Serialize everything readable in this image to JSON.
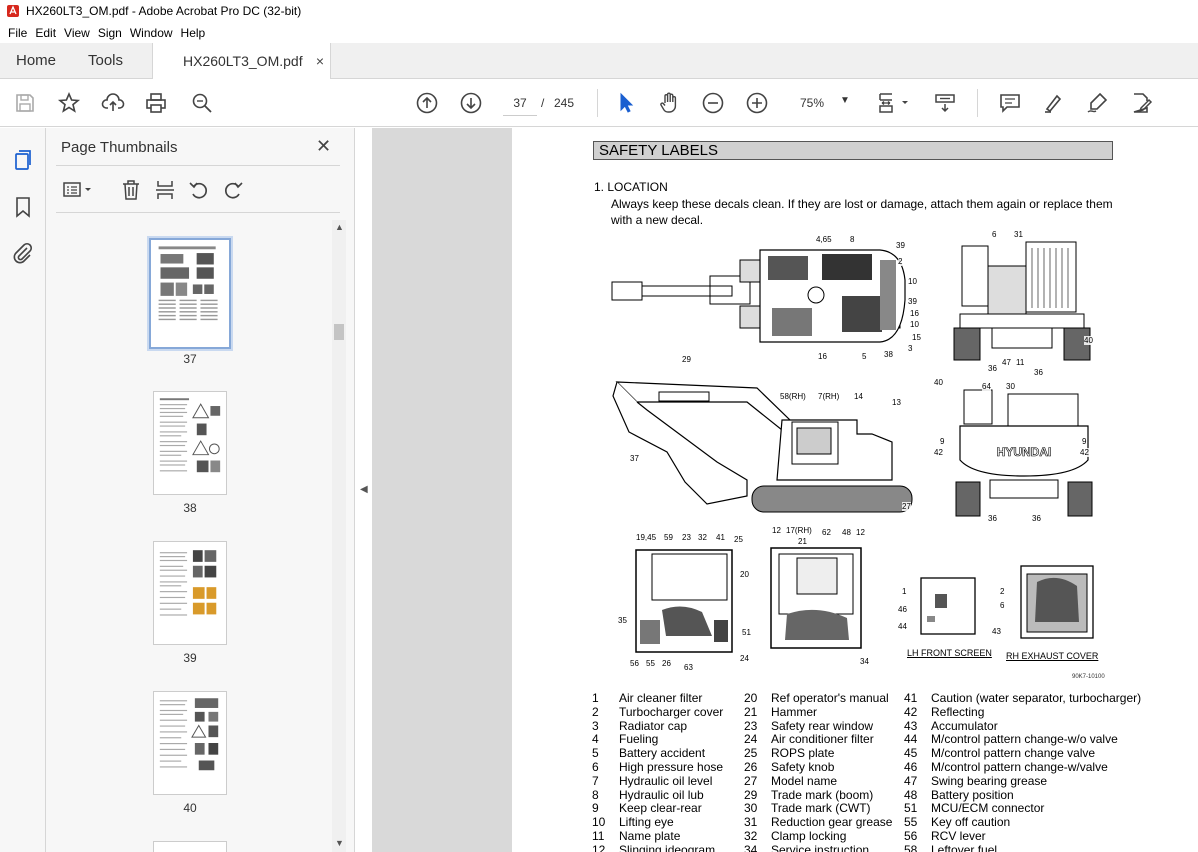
{
  "window": {
    "title": "HX260LT3_OM.pdf - Adobe Acrobat Pro DC (32-bit)"
  },
  "menu": [
    "File",
    "Edit",
    "View",
    "Sign",
    "Window",
    "Help"
  ],
  "tabs": {
    "home": "Home",
    "tools": "Tools",
    "doc": "HX260LT3_OM.pdf",
    "close": "×"
  },
  "toolbar": {
    "page_current": "37",
    "page_sep": "/",
    "page_total": "245",
    "zoom": "75%",
    "icons": [
      "save-icon",
      "star-icon",
      "upload-icon",
      "print-icon",
      "zoom-search-icon",
      "page-up-icon",
      "page-down-icon",
      "cursor-icon",
      "hand-icon",
      "zoom-out-icon",
      "zoom-in-icon",
      "fit-page-icon",
      "scroll-mode-icon",
      "comment-icon",
      "highlight-icon",
      "sign-icon",
      "edit-pdf-icon"
    ]
  },
  "sidebar": {
    "title": "Page Thumbnails",
    "close": "✕",
    "thumbnails": [
      {
        "label": "37",
        "selected": true
      },
      {
        "label": "38",
        "selected": false
      },
      {
        "label": "39",
        "selected": false
      },
      {
        "label": "40",
        "selected": false
      }
    ]
  },
  "doc": {
    "section_title": "SAFETY LABELS",
    "location_heading": "1.  LOCATION",
    "location_text": "Always keep these decals clean.  If they are lost or damage, attach them again or replace them with a new decal.",
    "figure_code": "90K7-10100",
    "captions": {
      "lh_front": "LH FRONT SCREEN",
      "rh_exhaust": "RH EXHAUST COVER"
    },
    "callouts": {
      "top": [
        "4,65",
        "8",
        "39",
        "2",
        "10",
        "39",
        "16",
        "10",
        "15",
        "3",
        "38",
        "5",
        "16"
      ],
      "rear": [
        "6",
        "31",
        "40",
        "36",
        "47",
        "11",
        "36"
      ],
      "side": [
        "29",
        "58(RH)",
        "7(RH)",
        "14",
        "13",
        "37",
        "27",
        "12",
        "17(RH)",
        "62",
        "48",
        "12"
      ],
      "rearview": [
        "40",
        "64",
        "30",
        "9",
        "42",
        "9",
        "42",
        "36",
        "36"
      ],
      "cab": [
        "19,45",
        "59",
        "23",
        "32",
        "41",
        "25",
        "20",
        "35",
        "51",
        "56",
        "55",
        "26",
        "63",
        "24"
      ],
      "cabfront": [
        "21",
        "34"
      ],
      "lhscreen": [
        "1",
        "46",
        "44"
      ],
      "rhcover": [
        "2",
        "6",
        "43"
      ]
    },
    "legend_col1": [
      [
        "1",
        "Air cleaner filter"
      ],
      [
        "2",
        "Turbocharger cover"
      ],
      [
        "3",
        "Radiator cap"
      ],
      [
        "4",
        "Fueling"
      ],
      [
        "5",
        "Battery accident"
      ],
      [
        "6",
        "High pressure hose"
      ],
      [
        "7",
        "Hydraulic oil level"
      ],
      [
        "8",
        "Hydraulic oil lub"
      ],
      [
        "9",
        "Keep clear-rear"
      ],
      [
        "10",
        "Lifting eye"
      ],
      [
        "11",
        "Name plate"
      ],
      [
        "12",
        "Slinging ideogram"
      ]
    ],
    "legend_col2": [
      [
        "20",
        "Ref operator's manual"
      ],
      [
        "21",
        "Hammer"
      ],
      [
        "23",
        "Safety rear window"
      ],
      [
        "24",
        "Air conditioner filter"
      ],
      [
        "25",
        "ROPS plate"
      ],
      [
        "26",
        "Safety knob"
      ],
      [
        "27",
        "Model name"
      ],
      [
        "29",
        "Trade mark (boom)"
      ],
      [
        "30",
        "Trade mark (CWT)"
      ],
      [
        "31",
        "Reduction gear grease"
      ],
      [
        "32",
        "Clamp locking"
      ],
      [
        "34",
        "Service instruction"
      ]
    ],
    "legend_col3": [
      [
        "41",
        "Caution (water separator, turbocharger)"
      ],
      [
        "42",
        "Reflecting"
      ],
      [
        "43",
        "Accumulator"
      ],
      [
        "44",
        "M/control pattern change-w/o valve"
      ],
      [
        "45",
        "M/control pattern change valve"
      ],
      [
        "46",
        "M/control pattern change-w/valve"
      ],
      [
        "47",
        "Swing bearing grease"
      ],
      [
        "48",
        "Battery position"
      ],
      [
        "51",
        "MCU/ECM connector"
      ],
      [
        "55",
        "Key off caution"
      ],
      [
        "56",
        "RCV lever"
      ],
      [
        "58",
        "Leftover fuel"
      ]
    ]
  }
}
